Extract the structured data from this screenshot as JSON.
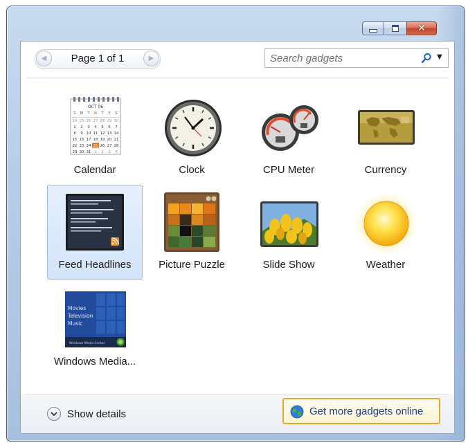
{
  "window": {
    "controls": [
      "minimize",
      "maximize",
      "close"
    ]
  },
  "nav": {
    "page_label": "Page 1 of 1",
    "search_placeholder": "Search gadgets"
  },
  "gadgets": [
    {
      "label": "Calendar",
      "icon": "calendar-icon",
      "selected": false
    },
    {
      "label": "Clock",
      "icon": "clock-icon",
      "selected": false
    },
    {
      "label": "CPU Meter",
      "icon": "cpu-meter-icon",
      "selected": false
    },
    {
      "label": "Currency",
      "icon": "currency-icon",
      "selected": false
    },
    {
      "label": "Feed Headlines",
      "icon": "feed-headlines-icon",
      "selected": true
    },
    {
      "label": "Picture Puzzle",
      "icon": "picture-puzzle-icon",
      "selected": false
    },
    {
      "label": "Slide Show",
      "icon": "slide-show-icon",
      "selected": false
    },
    {
      "label": "Weather",
      "icon": "weather-icon",
      "selected": false
    },
    {
      "label": "Windows Media...",
      "icon": "windows-media-center-icon",
      "selected": false
    }
  ],
  "calendar": {
    "month": "OCT 06",
    "weekdays": [
      "S",
      "M",
      "T",
      "W",
      "T",
      "F",
      "S"
    ],
    "highlight_day": "25"
  },
  "media_center": {
    "menu": [
      "Movies",
      "Television",
      "Music"
    ],
    "footer": "Windows Media Center"
  },
  "bottom": {
    "show_details": "Show details",
    "get_more": "Get more gadgets online"
  },
  "colors": {
    "selection": "#d3e4fa",
    "link": "#1e3f87",
    "highlight_border": "#e8a733"
  }
}
